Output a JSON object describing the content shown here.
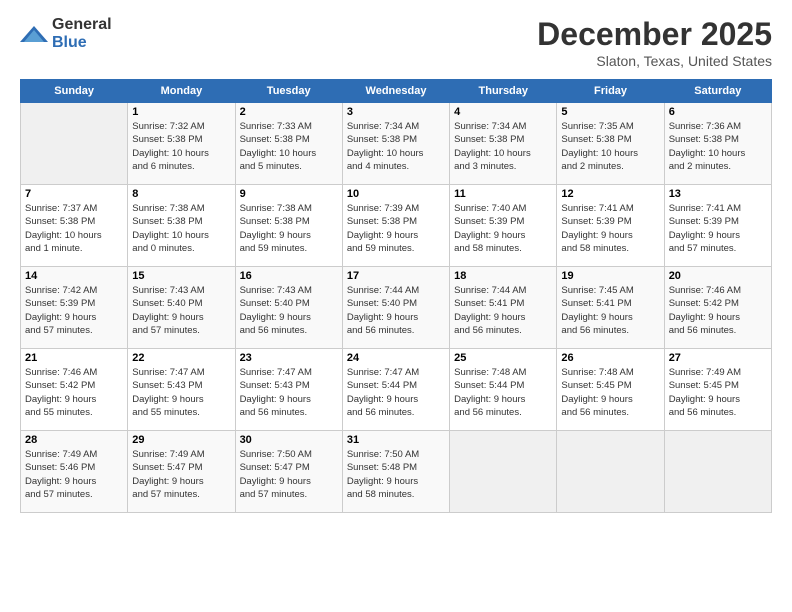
{
  "logo": {
    "general": "General",
    "blue": "Blue"
  },
  "header": {
    "title": "December 2025",
    "subtitle": "Slaton, Texas, United States"
  },
  "weekdays": [
    "Sunday",
    "Monday",
    "Tuesday",
    "Wednesday",
    "Thursday",
    "Friday",
    "Saturday"
  ],
  "weeks": [
    [
      {
        "day": "",
        "info": ""
      },
      {
        "day": "1",
        "info": "Sunrise: 7:32 AM\nSunset: 5:38 PM\nDaylight: 10 hours\nand 6 minutes."
      },
      {
        "day": "2",
        "info": "Sunrise: 7:33 AM\nSunset: 5:38 PM\nDaylight: 10 hours\nand 5 minutes."
      },
      {
        "day": "3",
        "info": "Sunrise: 7:34 AM\nSunset: 5:38 PM\nDaylight: 10 hours\nand 4 minutes."
      },
      {
        "day": "4",
        "info": "Sunrise: 7:34 AM\nSunset: 5:38 PM\nDaylight: 10 hours\nand 3 minutes."
      },
      {
        "day": "5",
        "info": "Sunrise: 7:35 AM\nSunset: 5:38 PM\nDaylight: 10 hours\nand 2 minutes."
      },
      {
        "day": "6",
        "info": "Sunrise: 7:36 AM\nSunset: 5:38 PM\nDaylight: 10 hours\nand 2 minutes."
      }
    ],
    [
      {
        "day": "7",
        "info": "Sunrise: 7:37 AM\nSunset: 5:38 PM\nDaylight: 10 hours\nand 1 minute."
      },
      {
        "day": "8",
        "info": "Sunrise: 7:38 AM\nSunset: 5:38 PM\nDaylight: 10 hours\nand 0 minutes."
      },
      {
        "day": "9",
        "info": "Sunrise: 7:38 AM\nSunset: 5:38 PM\nDaylight: 9 hours\nand 59 minutes."
      },
      {
        "day": "10",
        "info": "Sunrise: 7:39 AM\nSunset: 5:38 PM\nDaylight: 9 hours\nand 59 minutes."
      },
      {
        "day": "11",
        "info": "Sunrise: 7:40 AM\nSunset: 5:39 PM\nDaylight: 9 hours\nand 58 minutes."
      },
      {
        "day": "12",
        "info": "Sunrise: 7:41 AM\nSunset: 5:39 PM\nDaylight: 9 hours\nand 58 minutes."
      },
      {
        "day": "13",
        "info": "Sunrise: 7:41 AM\nSunset: 5:39 PM\nDaylight: 9 hours\nand 57 minutes."
      }
    ],
    [
      {
        "day": "14",
        "info": "Sunrise: 7:42 AM\nSunset: 5:39 PM\nDaylight: 9 hours\nand 57 minutes."
      },
      {
        "day": "15",
        "info": "Sunrise: 7:43 AM\nSunset: 5:40 PM\nDaylight: 9 hours\nand 57 minutes."
      },
      {
        "day": "16",
        "info": "Sunrise: 7:43 AM\nSunset: 5:40 PM\nDaylight: 9 hours\nand 56 minutes."
      },
      {
        "day": "17",
        "info": "Sunrise: 7:44 AM\nSunset: 5:40 PM\nDaylight: 9 hours\nand 56 minutes."
      },
      {
        "day": "18",
        "info": "Sunrise: 7:44 AM\nSunset: 5:41 PM\nDaylight: 9 hours\nand 56 minutes."
      },
      {
        "day": "19",
        "info": "Sunrise: 7:45 AM\nSunset: 5:41 PM\nDaylight: 9 hours\nand 56 minutes."
      },
      {
        "day": "20",
        "info": "Sunrise: 7:46 AM\nSunset: 5:42 PM\nDaylight: 9 hours\nand 56 minutes."
      }
    ],
    [
      {
        "day": "21",
        "info": "Sunrise: 7:46 AM\nSunset: 5:42 PM\nDaylight: 9 hours\nand 55 minutes."
      },
      {
        "day": "22",
        "info": "Sunrise: 7:47 AM\nSunset: 5:43 PM\nDaylight: 9 hours\nand 55 minutes."
      },
      {
        "day": "23",
        "info": "Sunrise: 7:47 AM\nSunset: 5:43 PM\nDaylight: 9 hours\nand 56 minutes."
      },
      {
        "day": "24",
        "info": "Sunrise: 7:47 AM\nSunset: 5:44 PM\nDaylight: 9 hours\nand 56 minutes."
      },
      {
        "day": "25",
        "info": "Sunrise: 7:48 AM\nSunset: 5:44 PM\nDaylight: 9 hours\nand 56 minutes."
      },
      {
        "day": "26",
        "info": "Sunrise: 7:48 AM\nSunset: 5:45 PM\nDaylight: 9 hours\nand 56 minutes."
      },
      {
        "day": "27",
        "info": "Sunrise: 7:49 AM\nSunset: 5:45 PM\nDaylight: 9 hours\nand 56 minutes."
      }
    ],
    [
      {
        "day": "28",
        "info": "Sunrise: 7:49 AM\nSunset: 5:46 PM\nDaylight: 9 hours\nand 57 minutes."
      },
      {
        "day": "29",
        "info": "Sunrise: 7:49 AM\nSunset: 5:47 PM\nDaylight: 9 hours\nand 57 minutes."
      },
      {
        "day": "30",
        "info": "Sunrise: 7:50 AM\nSunset: 5:47 PM\nDaylight: 9 hours\nand 57 minutes."
      },
      {
        "day": "31",
        "info": "Sunrise: 7:50 AM\nSunset: 5:48 PM\nDaylight: 9 hours\nand 58 minutes."
      },
      {
        "day": "",
        "info": ""
      },
      {
        "day": "",
        "info": ""
      },
      {
        "day": "",
        "info": ""
      }
    ]
  ]
}
